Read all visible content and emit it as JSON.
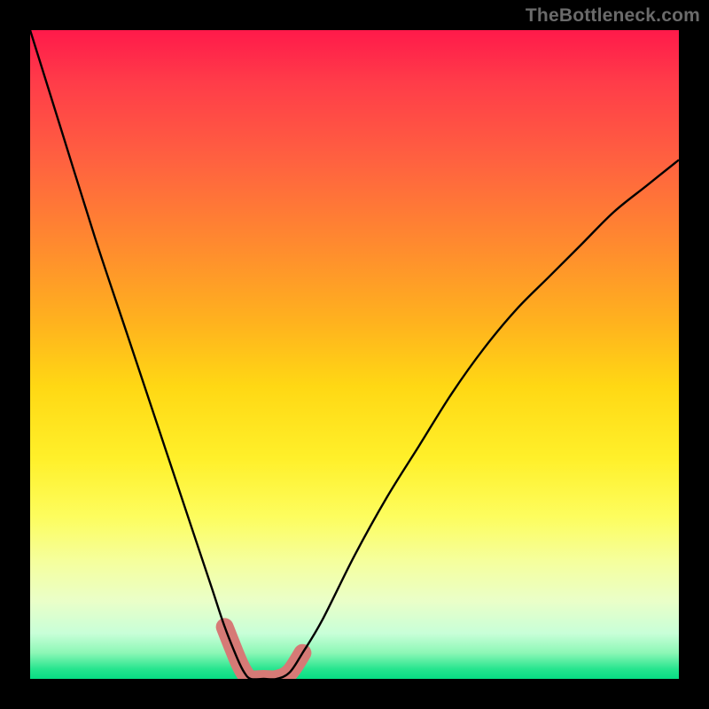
{
  "watermark": "TheBottleneck.com",
  "chart_data": {
    "type": "line",
    "title": "",
    "xlabel": "",
    "ylabel": "",
    "xlim": [
      0,
      100
    ],
    "ylim": [
      0,
      100
    ],
    "series": [
      {
        "name": "bottleneck-curve",
        "x": [
          0,
          5,
          10,
          15,
          20,
          25,
          28,
          30,
          32,
          33,
          34,
          36,
          38,
          40,
          42,
          45,
          50,
          55,
          60,
          65,
          70,
          75,
          80,
          85,
          90,
          95,
          100
        ],
        "values": [
          100,
          84,
          68,
          53,
          38,
          23,
          14,
          8,
          3,
          1,
          0,
          0,
          0,
          1,
          4,
          9,
          19,
          28,
          36,
          44,
          51,
          57,
          62,
          67,
          72,
          76,
          80
        ]
      }
    ],
    "highlight": {
      "name": "optimal-band",
      "x_range": [
        30,
        42
      ],
      "color": "#d67a76"
    },
    "gradient_stops": [
      {
        "pos": 0.0,
        "color": "#ff1a4a"
      },
      {
        "pos": 0.5,
        "color": "#ffd814"
      },
      {
        "pos": 0.8,
        "color": "#fdfd5e"
      },
      {
        "pos": 1.0,
        "color": "#07dd84"
      }
    ]
  }
}
